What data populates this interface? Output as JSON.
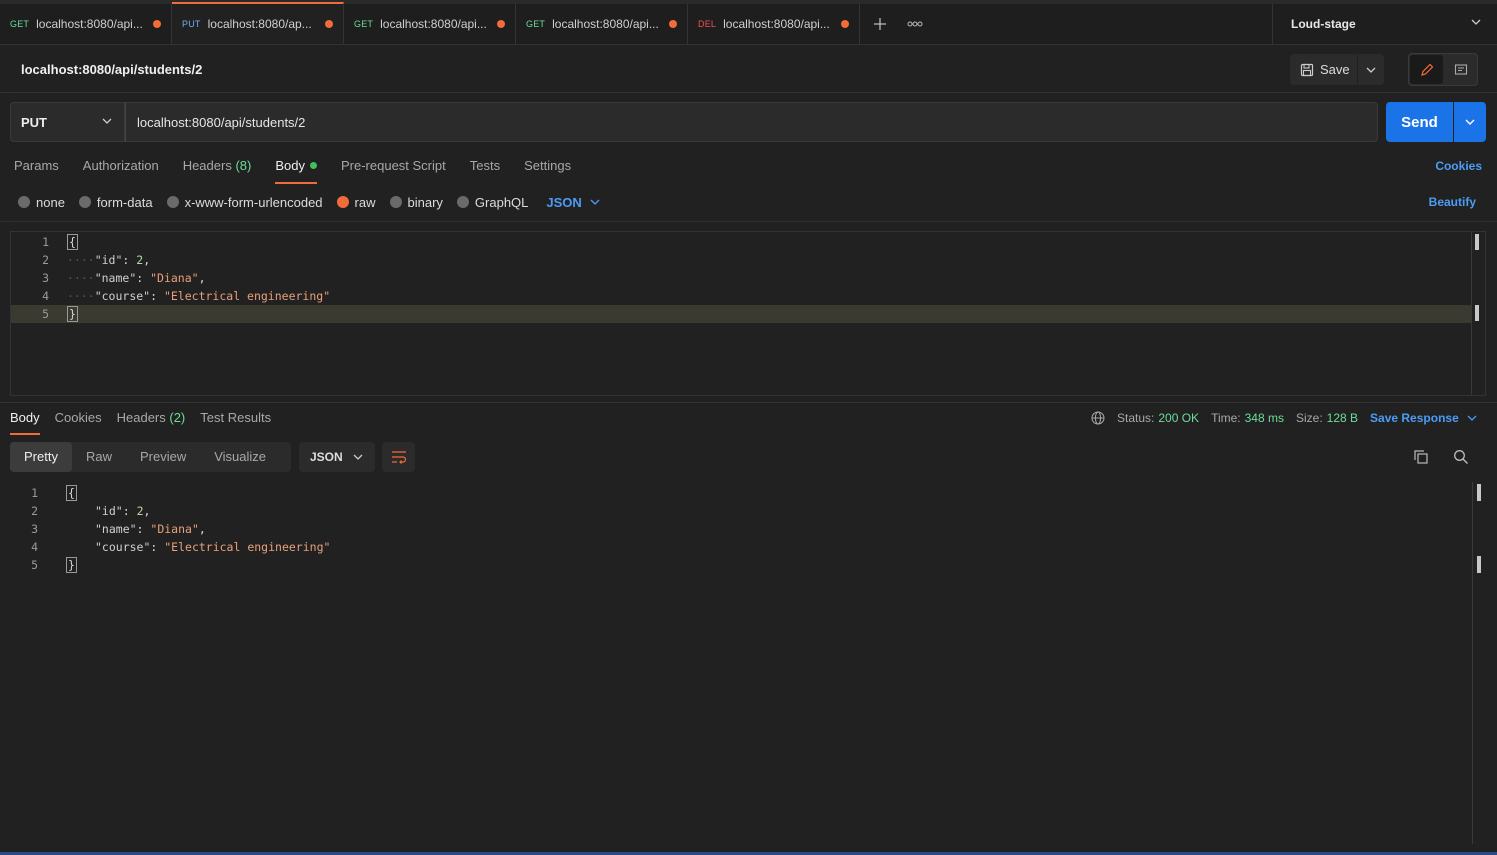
{
  "tabs": [
    {
      "method": "GET",
      "url": "localhost:8080/api...",
      "active": false
    },
    {
      "method": "PUT",
      "url": "localhost:8080/ap...",
      "active": true
    },
    {
      "method": "GET",
      "url": "localhost:8080/api...",
      "active": false
    },
    {
      "method": "GET",
      "url": "localhost:8080/api...",
      "active": false
    },
    {
      "method": "DEL",
      "url": "localhost:8080/api...",
      "active": false
    }
  ],
  "environment": "Loud-stage",
  "request": {
    "title": "localhost:8080/api/students/2",
    "save_label": "Save",
    "method": "PUT",
    "url": "localhost:8080/api/students/2",
    "send_label": "Send"
  },
  "request_tabs": {
    "params": "Params",
    "authorization": "Authorization",
    "headers": "Headers",
    "headers_count": "(8)",
    "body": "Body",
    "prerequest": "Pre-request Script",
    "tests": "Tests",
    "settings": "Settings",
    "cookies": "Cookies"
  },
  "body_types": {
    "none": "none",
    "form_data": "form-data",
    "urlencoded": "x-www-form-urlencoded",
    "raw": "raw",
    "binary": "binary",
    "graphql": "GraphQL",
    "language": "JSON",
    "beautify": "Beautify"
  },
  "request_body": {
    "line_numbers": [
      "1",
      "2",
      "3",
      "4",
      "5"
    ],
    "open_brace": "{",
    "close_brace": "}",
    "id_key": "\"id\"",
    "id_value": "2",
    "name_key": "\"name\"",
    "name_value": "\"Diana\"",
    "course_key": "\"course\"",
    "course_value": "\"Electrical engineering\""
  },
  "response_tabs": {
    "body": "Body",
    "cookies": "Cookies",
    "headers": "Headers",
    "headers_count": "(2)",
    "test_results": "Test Results"
  },
  "response_meta": {
    "status_label": "Status:",
    "status_value": "200 OK",
    "time_label": "Time:",
    "time_value": "348 ms",
    "size_label": "Size:",
    "size_value": "128 B",
    "save_response": "Save Response"
  },
  "view_tabs": {
    "pretty": "Pretty",
    "raw": "Raw",
    "preview": "Preview",
    "visualize": "Visualize",
    "format": "JSON"
  },
  "response_body": {
    "line_numbers": [
      "1",
      "2",
      "3",
      "4",
      "5"
    ],
    "open_brace": "{",
    "close_brace": "}",
    "id_key": "\"id\"",
    "id_value": "2",
    "name_key": "\"name\"",
    "name_value": "\"Diana\"",
    "course_key": "\"course\"",
    "course_value": "\"Electrical engineering\""
  },
  "colors": {
    "accent": "#f26b3a",
    "primary_blue": "#1b73e8",
    "link_blue": "#4c9cf5",
    "success_green": "#6bdd9a"
  }
}
